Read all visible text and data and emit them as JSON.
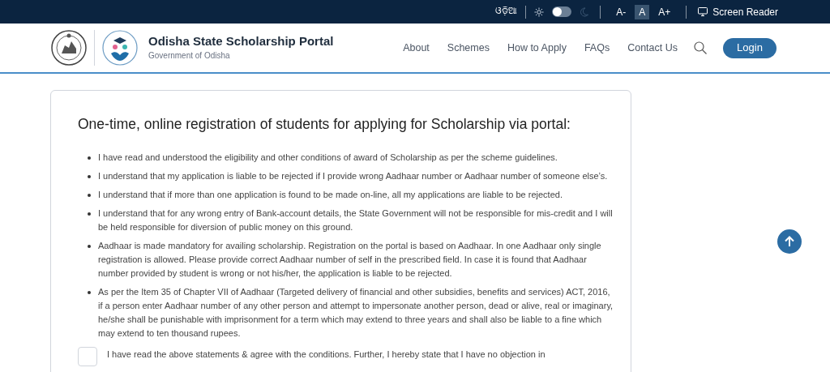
{
  "top_bar": {
    "language": "ଓଡ଼ିଆ",
    "dark_mode": false,
    "font_sizes": [
      {
        "label": "A-",
        "selected": false
      },
      {
        "label": "A",
        "selected": true
      },
      {
        "label": "A+",
        "selected": false
      }
    ],
    "screen_reader": "Screen Reader"
  },
  "header": {
    "title": "Odisha State Scholarship Portal",
    "subtitle": "Government of Odisha",
    "nav": [
      "About",
      "Schemes",
      "How to Apply",
      "FAQs",
      "Contact Us"
    ],
    "login": "Login"
  },
  "card": {
    "heading": "One-time, online registration of students for applying for Scholarship via portal:",
    "statements": [
      "I have read and understood the eligibility and other conditions of award of Scholarship as per the scheme guidelines.",
      "I understand that my application is liable to be rejected if I provide wrong Aadhaar number or Aadhaar number of someone else’s.",
      "I understand that if more than one application is found to be made on-line, all my applications are liable to be rejected.",
      "I understand that for any wrong entry of Bank-account details, the State Government will not be responsible for mis-credit and I will be held responsible for diversion of public money on this ground.",
      "Aadhaar is made mandatory for availing scholarship. Registration on the portal is based on Aadhaar. In one Aadhaar only single registration is allowed. Please provide correct Aadhaar number of self in the prescribed field. In case it is found that Aadhaar number provided by student is wrong or not his/her, the application is liable to be rejected.",
      "As per the Item 35 of Chapter VII of Aadhaar (Targeted delivery of financial and other subsidies, benefits and services) ACT, 2016, if a person enter Aadhaar number of any other person and attempt to impersonate another person, dead or alive, real or imaginary, he/she shall be punishable with imprisonment for a term which may extend to three years and shall also be liable to a fine which may extend to ten thousand rupees."
    ],
    "agreement": {
      "checked": false,
      "text": "I have read the above statements & agree with the conditions. Further, I hereby state that I have no objection in"
    }
  }
}
